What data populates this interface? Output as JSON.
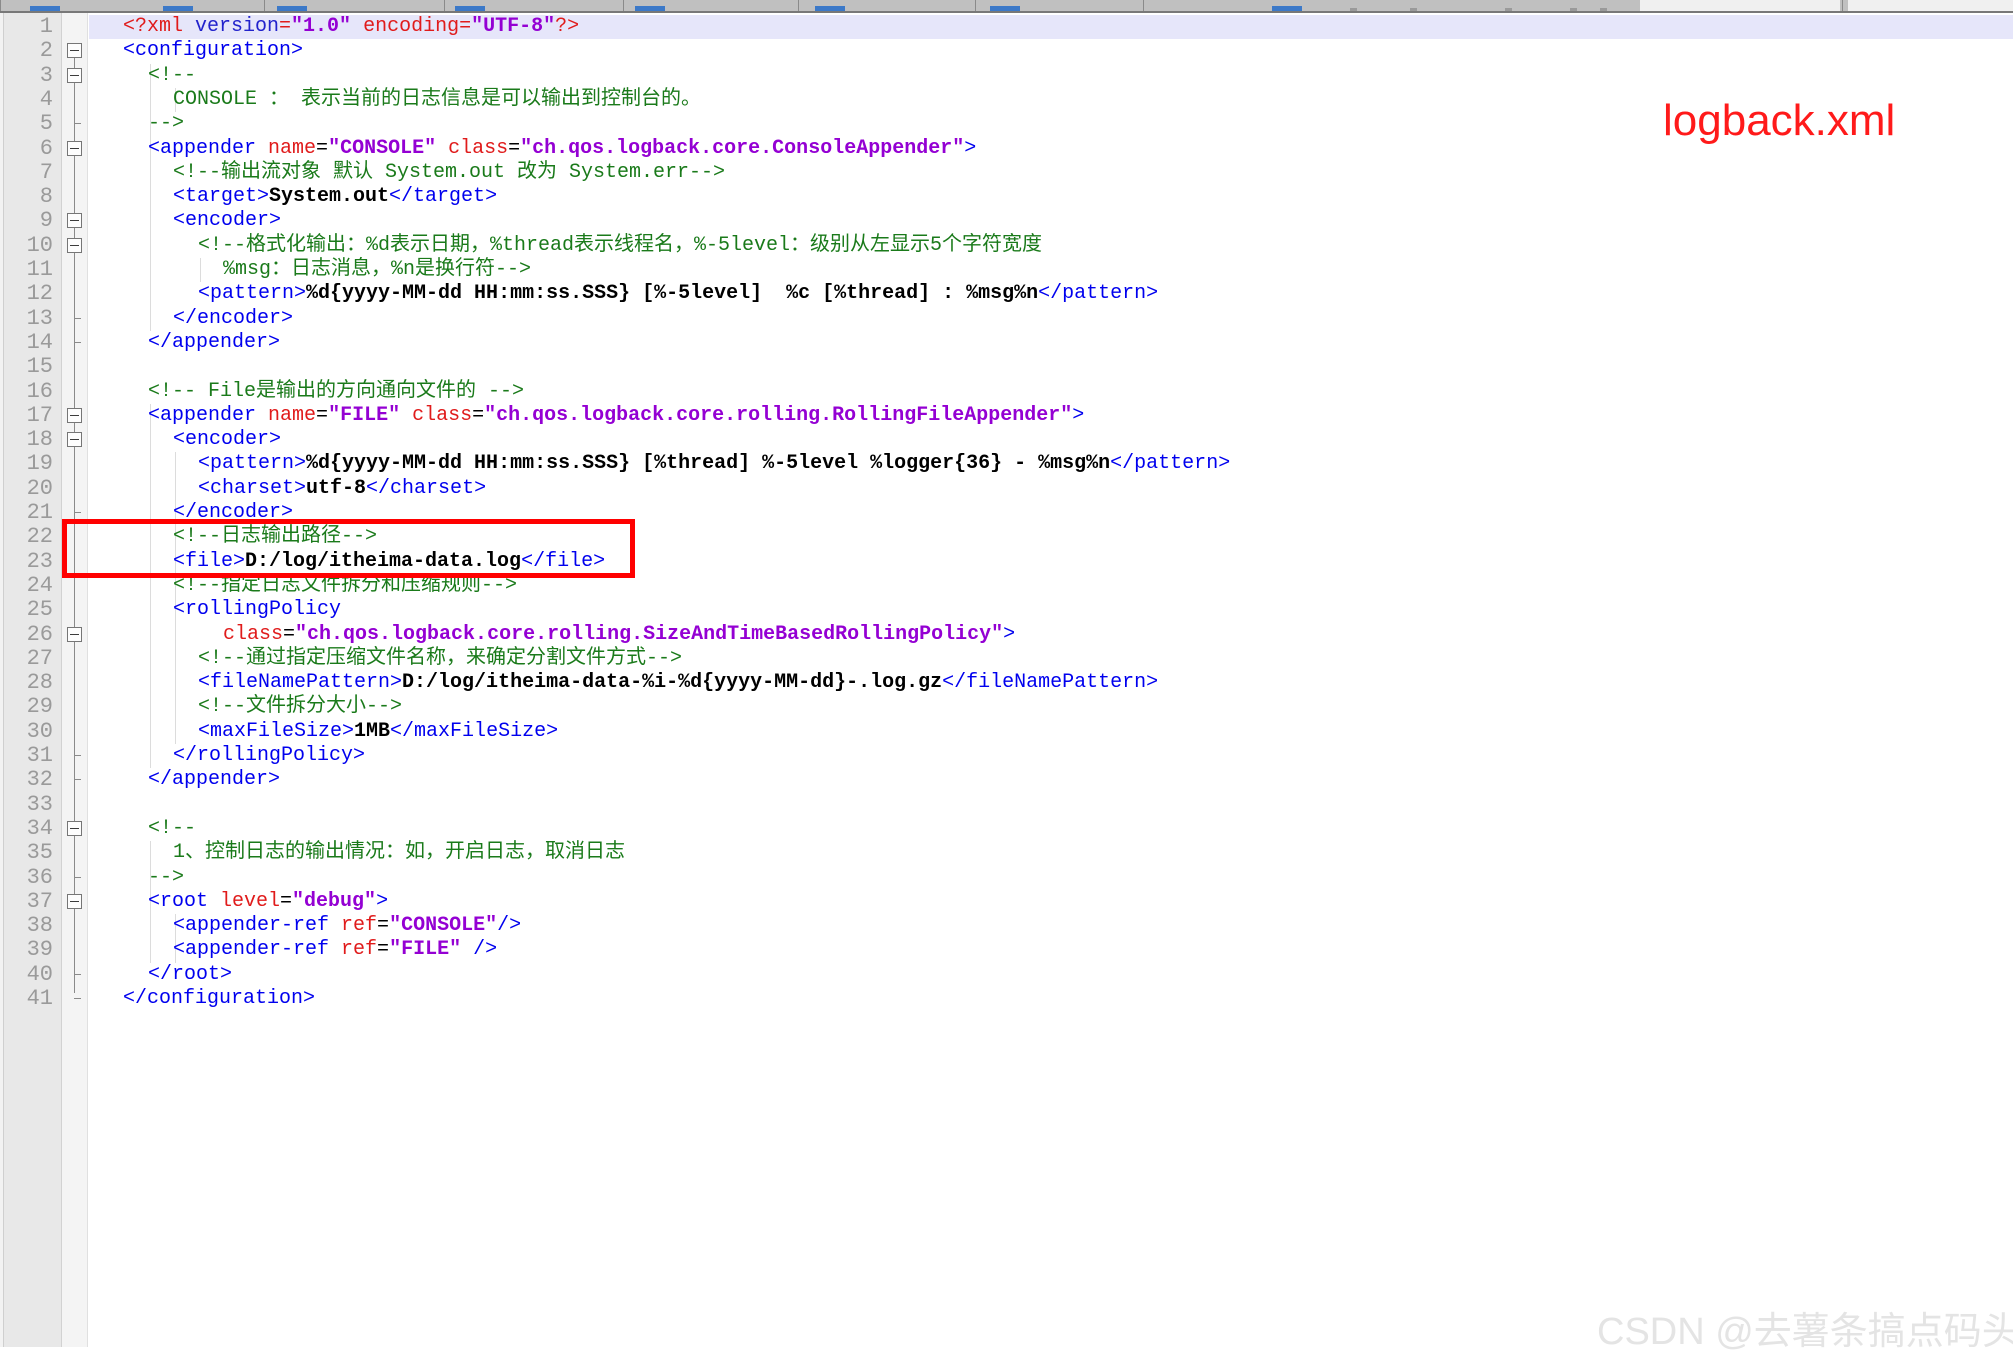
{
  "window": {
    "toolbar_visible": true
  },
  "annotations": {
    "file_label": "logback.xml",
    "file_label_color": "#ff1a1a",
    "highlight_box_color": "#ff0000",
    "highlight_box_lines": [
      22,
      23
    ],
    "watermark": "CSDN @去薯条搞点码头"
  },
  "editor": {
    "language": "xml",
    "current_line": 1,
    "current_line_color": "#e6e6fa",
    "gutter_color": "#e8e8e8",
    "line_number_color": "#9a9a9a",
    "total_lines": 41,
    "fold_marker_lines": [
      2,
      3,
      6,
      9,
      10,
      17,
      18,
      26,
      34,
      37
    ],
    "fold_tick_lines": [
      5,
      13,
      14,
      21,
      31,
      32,
      36,
      40,
      41
    ],
    "colors": {
      "tag": "#0000ee",
      "attribute": "#e01b1b",
      "attribute_value": "#9400d3",
      "text": "#000000",
      "comment": "#1a7a1a",
      "background": "#ffffff"
    },
    "line_numbers": [
      1,
      2,
      3,
      4,
      5,
      6,
      7,
      8,
      9,
      10,
      11,
      12,
      13,
      14,
      15,
      16,
      17,
      18,
      19,
      20,
      21,
      22,
      23,
      24,
      25,
      26,
      27,
      28,
      29,
      30,
      31,
      32,
      33,
      34,
      35,
      36,
      37,
      38,
      39,
      40,
      41
    ],
    "lines": [
      {
        "n": 1,
        "indent": 0,
        "tokens": [
          {
            "c": "t-pi",
            "t": "<?xml "
          },
          {
            "c": "t-pi-name",
            "t": "version"
          },
          {
            "c": "t-pi",
            "t": "="
          },
          {
            "c": "t-val",
            "t": "\"1.0\""
          },
          {
            "c": "t-pi",
            "t": " encoding"
          },
          {
            "c": "t-pi",
            "t": "="
          },
          {
            "c": "t-val",
            "t": "\"UTF-8\""
          },
          {
            "c": "t-pi",
            "t": "?>"
          }
        ]
      },
      {
        "n": 2,
        "indent": 0,
        "tokens": [
          {
            "c": "t-tag",
            "t": "<configuration>"
          }
        ]
      },
      {
        "n": 3,
        "indent": 1,
        "tokens": [
          {
            "c": "t-comment",
            "t": "<!--"
          }
        ]
      },
      {
        "n": 4,
        "indent": 2,
        "tokens": [
          {
            "c": "t-comment",
            "t": "CONSOLE ： 表示当前的日志信息是可以输出到控制台的。"
          }
        ]
      },
      {
        "n": 5,
        "indent": 1,
        "tokens": [
          {
            "c": "t-comment",
            "t": "-->"
          }
        ]
      },
      {
        "n": 6,
        "indent": 1,
        "tokens": [
          {
            "c": "t-tag",
            "t": "<appender "
          },
          {
            "c": "t-attr",
            "t": "name"
          },
          {
            "c": "t-punct",
            "t": "="
          },
          {
            "c": "t-val",
            "t": "\"CONSOLE\""
          },
          {
            "c": "t-punct",
            "t": " "
          },
          {
            "c": "t-attr",
            "t": "class"
          },
          {
            "c": "t-punct",
            "t": "="
          },
          {
            "c": "t-val",
            "t": "\"ch.qos.logback.core.ConsoleAppender\""
          },
          {
            "c": "t-tag",
            "t": ">"
          }
        ]
      },
      {
        "n": 7,
        "indent": 2,
        "tokens": [
          {
            "c": "t-comment",
            "t": "<!--输出流对象 默认 System.out 改为 System.err-->"
          }
        ]
      },
      {
        "n": 8,
        "indent": 2,
        "tokens": [
          {
            "c": "t-tag",
            "t": "<target>"
          },
          {
            "c": "t-text",
            "t": "System.out"
          },
          {
            "c": "t-tag",
            "t": "</target>"
          }
        ]
      },
      {
        "n": 9,
        "indent": 2,
        "tokens": [
          {
            "c": "t-tag",
            "t": "<encoder>"
          }
        ]
      },
      {
        "n": 10,
        "indent": 3,
        "tokens": [
          {
            "c": "t-comment",
            "t": "<!--格式化输出：%d表示日期，%thread表示线程名，%-5level：级别从左显示5个字符宽度"
          }
        ]
      },
      {
        "n": 11,
        "indent": 4,
        "tokens": [
          {
            "c": "t-comment",
            "t": "%msg：日志消息，%n是换行符-->"
          }
        ]
      },
      {
        "n": 12,
        "indent": 3,
        "tokens": [
          {
            "c": "t-tag",
            "t": "<pattern>"
          },
          {
            "c": "t-text",
            "t": "%d{yyyy-MM-dd HH:mm:ss.SSS} [%-5level]  %c [%thread] : %msg%n"
          },
          {
            "c": "t-tag",
            "t": "</pattern>"
          }
        ]
      },
      {
        "n": 13,
        "indent": 2,
        "tokens": [
          {
            "c": "t-tag",
            "t": "</encoder>"
          }
        ]
      },
      {
        "n": 14,
        "indent": 1,
        "tokens": [
          {
            "c": "t-tag",
            "t": "</appender>"
          }
        ]
      },
      {
        "n": 15,
        "indent": 0,
        "tokens": []
      },
      {
        "n": 16,
        "indent": 1,
        "tokens": [
          {
            "c": "t-comment",
            "t": "<!-- File是输出的方向通向文件的 -->"
          }
        ]
      },
      {
        "n": 17,
        "indent": 1,
        "tokens": [
          {
            "c": "t-tag",
            "t": "<appender "
          },
          {
            "c": "t-attr",
            "t": "name"
          },
          {
            "c": "t-punct",
            "t": "="
          },
          {
            "c": "t-val",
            "t": "\"FILE\""
          },
          {
            "c": "t-punct",
            "t": " "
          },
          {
            "c": "t-attr",
            "t": "class"
          },
          {
            "c": "t-punct",
            "t": "="
          },
          {
            "c": "t-val",
            "t": "\"ch.qos.logback.core.rolling.RollingFileAppender\""
          },
          {
            "c": "t-tag",
            "t": ">"
          }
        ]
      },
      {
        "n": 18,
        "indent": 2,
        "tokens": [
          {
            "c": "t-tag",
            "t": "<encoder>"
          }
        ]
      },
      {
        "n": 19,
        "indent": 3,
        "tokens": [
          {
            "c": "t-tag",
            "t": "<pattern>"
          },
          {
            "c": "t-text",
            "t": "%d{yyyy-MM-dd HH:mm:ss.SSS} [%thread] %-5level %logger{36} - %msg%n"
          },
          {
            "c": "t-tag",
            "t": "</pattern>"
          }
        ]
      },
      {
        "n": 20,
        "indent": 3,
        "tokens": [
          {
            "c": "t-tag",
            "t": "<charset>"
          },
          {
            "c": "t-text",
            "t": "utf-8"
          },
          {
            "c": "t-tag",
            "t": "</charset>"
          }
        ]
      },
      {
        "n": 21,
        "indent": 2,
        "tokens": [
          {
            "c": "t-tag",
            "t": "</encoder>"
          }
        ]
      },
      {
        "n": 22,
        "indent": 2,
        "tokens": [
          {
            "c": "t-comment",
            "t": "<!--日志输出路径-->"
          }
        ]
      },
      {
        "n": 23,
        "indent": 2,
        "tokens": [
          {
            "c": "t-tag",
            "t": "<file>"
          },
          {
            "c": "t-text",
            "t": "D:/log/itheima-data.log"
          },
          {
            "c": "t-tag",
            "t": "</file>"
          }
        ]
      },
      {
        "n": 24,
        "indent": 2,
        "tokens": [
          {
            "c": "t-comment",
            "t": "<!--指定日志文件拆分和压缩规则-->"
          }
        ]
      },
      {
        "n": 25,
        "indent": 2,
        "tokens": [
          {
            "c": "t-tag",
            "t": "<rollingPolicy"
          }
        ]
      },
      {
        "n": 26,
        "indent": 4,
        "tokens": [
          {
            "c": "t-attr",
            "t": "class"
          },
          {
            "c": "t-punct",
            "t": "="
          },
          {
            "c": "t-val",
            "t": "\"ch.qos.logback.core.rolling.SizeAndTimeBasedRollingPolicy\""
          },
          {
            "c": "t-tag",
            "t": ">"
          }
        ]
      },
      {
        "n": 27,
        "indent": 3,
        "tokens": [
          {
            "c": "t-comment",
            "t": "<!--通过指定压缩文件名称，来确定分割文件方式-->"
          }
        ]
      },
      {
        "n": 28,
        "indent": 3,
        "tokens": [
          {
            "c": "t-tag",
            "t": "<fileNamePattern>"
          },
          {
            "c": "t-text",
            "t": "D:/log/itheima-data-%i-%d{yyyy-MM-dd}-.log.gz"
          },
          {
            "c": "t-tag",
            "t": "</fileNamePattern>"
          }
        ]
      },
      {
        "n": 29,
        "indent": 3,
        "tokens": [
          {
            "c": "t-comment",
            "t": "<!--文件拆分大小-->"
          }
        ]
      },
      {
        "n": 30,
        "indent": 3,
        "tokens": [
          {
            "c": "t-tag",
            "t": "<maxFileSize>"
          },
          {
            "c": "t-text",
            "t": "1MB"
          },
          {
            "c": "t-tag",
            "t": "</maxFileSize>"
          }
        ]
      },
      {
        "n": 31,
        "indent": 2,
        "tokens": [
          {
            "c": "t-tag",
            "t": "</rollingPolicy>"
          }
        ]
      },
      {
        "n": 32,
        "indent": 1,
        "tokens": [
          {
            "c": "t-tag",
            "t": "</appender>"
          }
        ]
      },
      {
        "n": 33,
        "indent": 0,
        "tokens": []
      },
      {
        "n": 34,
        "indent": 1,
        "tokens": [
          {
            "c": "t-comment",
            "t": "<!--"
          }
        ]
      },
      {
        "n": 35,
        "indent": 2,
        "tokens": [
          {
            "c": "t-comment",
            "t": "1、控制日志的输出情况：如，开启日志，取消日志"
          }
        ]
      },
      {
        "n": 36,
        "indent": 1,
        "tokens": [
          {
            "c": "t-comment",
            "t": "-->"
          }
        ]
      },
      {
        "n": 37,
        "indent": 1,
        "tokens": [
          {
            "c": "t-tag",
            "t": "<root "
          },
          {
            "c": "t-attr",
            "t": "level"
          },
          {
            "c": "t-punct",
            "t": "="
          },
          {
            "c": "t-val",
            "t": "\"debug\""
          },
          {
            "c": "t-tag",
            "t": ">"
          }
        ]
      },
      {
        "n": 38,
        "indent": 2,
        "tokens": [
          {
            "c": "t-tag",
            "t": "<appender-ref "
          },
          {
            "c": "t-attr",
            "t": "ref"
          },
          {
            "c": "t-punct",
            "t": "="
          },
          {
            "c": "t-val",
            "t": "\"CONSOLE\""
          },
          {
            "c": "t-tag",
            "t": "/>"
          }
        ]
      },
      {
        "n": 39,
        "indent": 2,
        "tokens": [
          {
            "c": "t-tag",
            "t": "<appender-ref "
          },
          {
            "c": "t-attr",
            "t": "ref"
          },
          {
            "c": "t-punct",
            "t": "="
          },
          {
            "c": "t-val",
            "t": "\"FILE\""
          },
          {
            "c": "t-tag",
            "t": " />"
          }
        ]
      },
      {
        "n": 40,
        "indent": 1,
        "tokens": [
          {
            "c": "t-tag",
            "t": "</root>"
          }
        ]
      },
      {
        "n": 41,
        "indent": 0,
        "tokens": [
          {
            "c": "t-tag",
            "t": "</configuration>"
          }
        ]
      }
    ]
  }
}
